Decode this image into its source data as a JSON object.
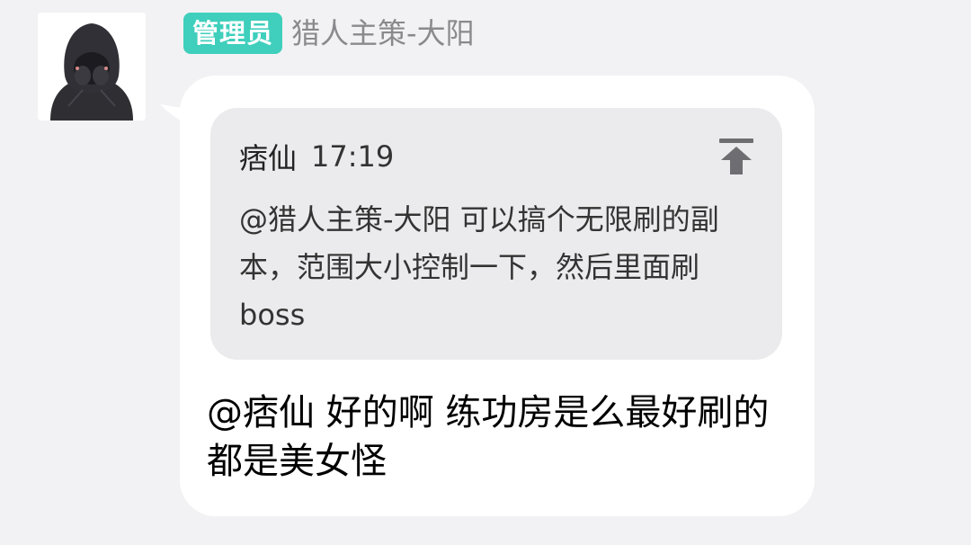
{
  "sender": {
    "role_badge": "管理员",
    "name": "猎人主策-大阳"
  },
  "message": {
    "quote": {
      "author": "痞仙",
      "time": "17:19",
      "text": "@猎人主策-大阳 可以搞个无限刷的副本，范围大小控制一下，然后里面刷boss"
    },
    "reply_text": "@痞仙 好的啊  练功房是么最好刷的都是美女怪"
  },
  "colors": {
    "background": "#f2f2f4",
    "bubble": "#ffffff",
    "quote_background": "#ebebed",
    "role_badge": "#3fcfbc",
    "sender_name": "#8a8a8e"
  },
  "icons": {
    "avatar": "hooded-figure-avatar",
    "jump": "arrow-to-top-icon"
  }
}
